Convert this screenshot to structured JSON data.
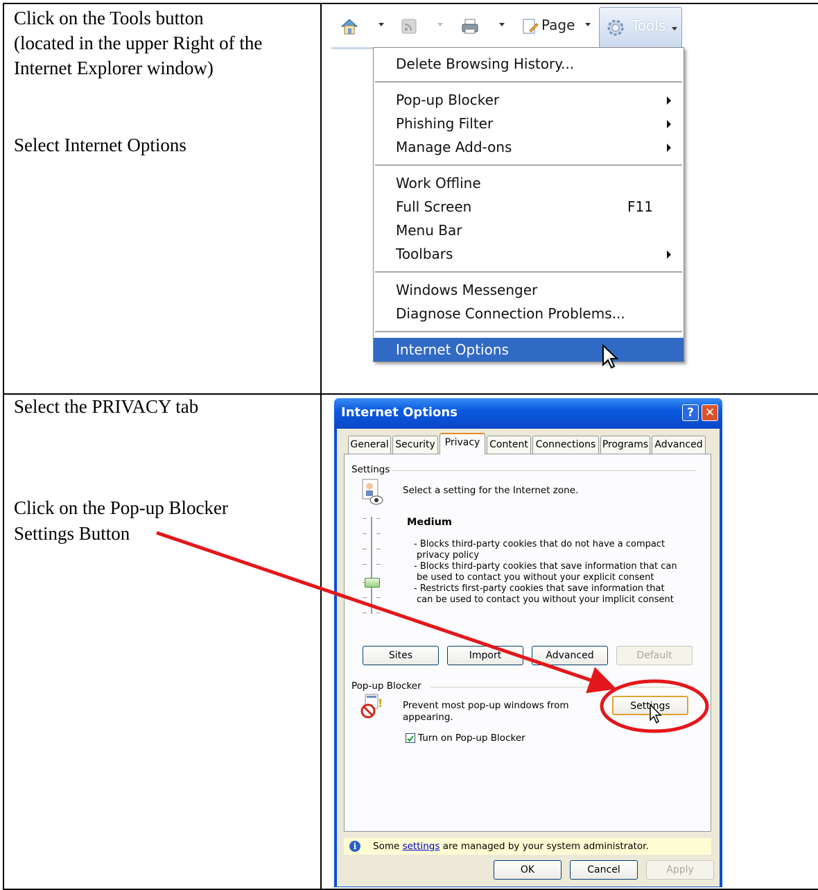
{
  "instructions": {
    "row1": {
      "line1": "Click on the Tools button",
      "line2": "(located in the upper Right of the",
      "line3": "Internet Explorer window)",
      "line4": "Select Internet Options"
    },
    "row2": {
      "line1": "Select the  PRIVACY tab",
      "line2": "Click on the Pop-up Blocker",
      "line3": "Settings Button"
    }
  },
  "ie_toolbar": {
    "page_label": "Page",
    "tools_label": "Tools",
    "icons": [
      "home-icon",
      "feeds-icon",
      "print-icon",
      "page-icon",
      "gear-icon"
    ]
  },
  "tools_menu": {
    "items": [
      {
        "label": "Delete Browsing History...",
        "shortcut": "",
        "submenu": false
      },
      {
        "label": "Pop-up Blocker",
        "shortcut": "",
        "submenu": true
      },
      {
        "label": "Phishing Filter",
        "shortcut": "",
        "submenu": true
      },
      {
        "label": "Manage Add-ons",
        "shortcut": "",
        "submenu": true
      },
      {
        "label": "Work Offline",
        "shortcut": "",
        "submenu": false
      },
      {
        "label": "Full Screen",
        "shortcut": "F11",
        "submenu": false
      },
      {
        "label": "Menu Bar",
        "shortcut": "",
        "submenu": false
      },
      {
        "label": "Toolbars",
        "shortcut": "",
        "submenu": true
      },
      {
        "label": "Windows Messenger",
        "shortcut": "",
        "submenu": false
      },
      {
        "label": "Diagnose Connection Problems...",
        "shortcut": "",
        "submenu": false
      },
      {
        "label": "Internet Options",
        "shortcut": "",
        "submenu": false,
        "highlighted": true
      }
    ]
  },
  "dialog": {
    "title": "Internet Options",
    "help_glyph": "?",
    "close_glyph": "✕",
    "tabs": [
      "General",
      "Security",
      "Privacy",
      "Content",
      "Connections",
      "Programs",
      "Advanced"
    ],
    "active_tab": "Privacy",
    "settings_group": "Settings",
    "zone_text": "Select a setting for the Internet zone.",
    "level": "Medium",
    "description": [
      "- Blocks third-party cookies that do not have a compact",
      "privacy policy",
      "- Blocks third-party cookies that save information that can",
      "be used to contact you without your explicit consent",
      "- Restricts first-party cookies that save information that",
      "can be used to contact you without your implicit consent"
    ],
    "buttons": {
      "sites": "Sites",
      "import": "Import",
      "advanced": "Advanced",
      "default": "Default"
    },
    "popup_group": "Pop-up Blocker",
    "popup_text_1": "Prevent most pop-up windows from",
    "popup_text_2": "appearing.",
    "settings_button": "Settings",
    "checkbox_label": "Turn on Pop-up Blocker",
    "checkbox_checked": true,
    "info_prefix": "Some ",
    "info_link": "settings",
    "info_suffix": " are managed by your system administrator.",
    "ok": "OK",
    "cancel": "Cancel",
    "apply": "Apply"
  },
  "colors": {
    "annotation_red": "#e3171b",
    "menu_highlight": "#316ac5",
    "xp_title_blue": "#0a47c7"
  }
}
